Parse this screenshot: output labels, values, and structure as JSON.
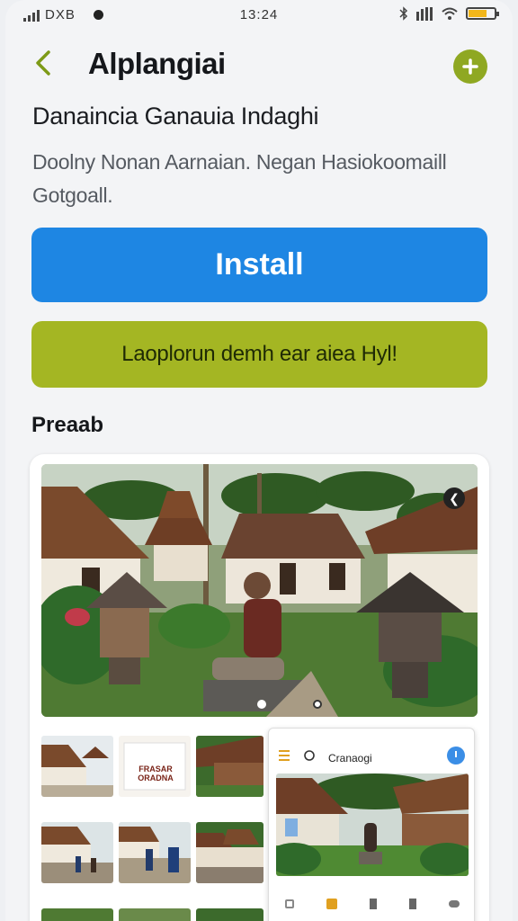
{
  "status_bar": {
    "left_text": "DXB",
    "time": "13:24"
  },
  "header": {
    "title": "Alplangiai"
  },
  "app": {
    "subtitle": "Danaincia Ganauia Indaghi",
    "description": "Doolny Nonan Aarnaian. Negan Hasiokoomaill Gotgoall."
  },
  "buttons": {
    "install": "Install",
    "secondary": "Laoplorun demh ear aiea Hyl!"
  },
  "section": {
    "preview_title": "Preaab"
  },
  "preview": {
    "thumb_poster_text": "FRASAR ORADNA",
    "inner_screen_title": "Cranaogi"
  },
  "colors": {
    "install_button": "#1e86e3",
    "secondary_button": "#a4b623",
    "accent_add": "#8fa822"
  }
}
